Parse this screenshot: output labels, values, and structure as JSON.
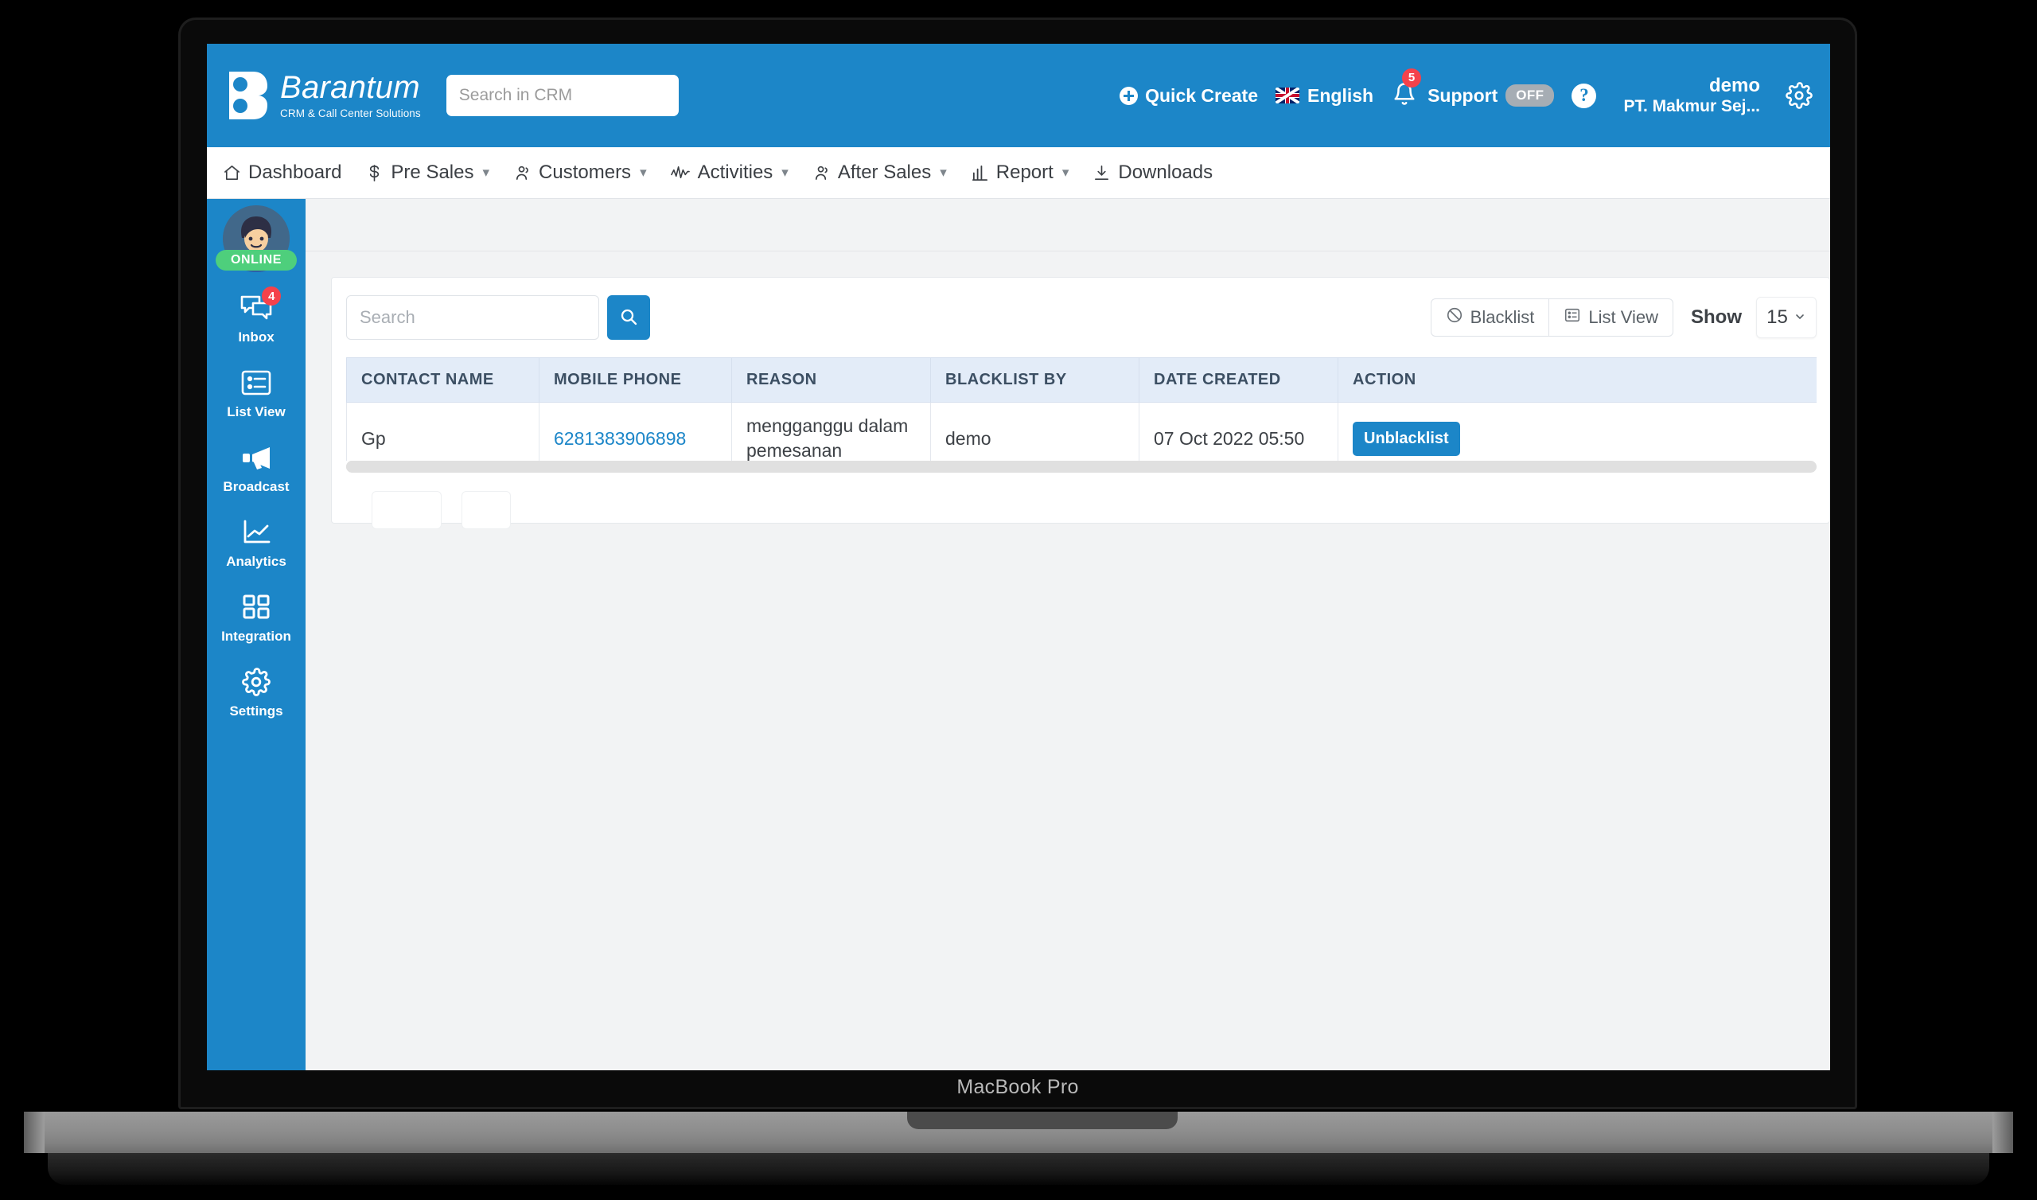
{
  "device": {
    "label": "MacBook Pro"
  },
  "header": {
    "brand_name": "Barantum",
    "brand_tagline": "CRM & Call Center Solutions",
    "search_placeholder": "Search in CRM",
    "search_value": "",
    "quick_create": "Quick Create",
    "language": "English",
    "notifications_count": "5",
    "support_label": "Support",
    "support_state": "OFF",
    "help": "?",
    "user_name": "demo",
    "user_company": "PT. Makmur Sej...",
    "accent_color": "#1c86c8"
  },
  "nav": {
    "items": [
      {
        "label": "Dashboard",
        "icon": "home-icon",
        "caret": false
      },
      {
        "label": "Pre Sales",
        "icon": "dollar-icon",
        "caret": true
      },
      {
        "label": "Customers",
        "icon": "people-icon",
        "caret": true
      },
      {
        "label": "Activities",
        "icon": "activity-icon",
        "caret": true
      },
      {
        "label": "After Sales",
        "icon": "people-icon",
        "caret": true
      },
      {
        "label": "Report",
        "icon": "bar-chart-icon",
        "caret": true
      },
      {
        "label": "Downloads",
        "icon": "download-icon",
        "caret": false
      }
    ]
  },
  "sidebar": {
    "status": "ONLINE",
    "items": [
      {
        "label": "Inbox",
        "icon": "chat-icon",
        "badge": "4"
      },
      {
        "label": "List View",
        "icon": "list-icon",
        "badge": ""
      },
      {
        "label": "Broadcast",
        "icon": "megaphone-icon",
        "badge": ""
      },
      {
        "label": "Analytics",
        "icon": "line-chart-icon",
        "badge": ""
      },
      {
        "label": "Integration",
        "icon": "grid-icon",
        "badge": ""
      },
      {
        "label": "Settings",
        "icon": "gear-icon",
        "badge": ""
      }
    ]
  },
  "toolbar": {
    "search_placeholder": "Search",
    "search_value": "",
    "blacklist_label": "Blacklist",
    "listview_label": "List View",
    "show_label": "Show",
    "page_size": "15"
  },
  "table": {
    "columns": [
      "CONTACT NAME",
      "MOBILE PHONE",
      "REASON",
      "BLACKLIST BY",
      "DATE CREATED",
      "ACTION"
    ],
    "rows": [
      {
        "contact_name": "Gp",
        "mobile_phone": "6281383906898",
        "reason": "mengganggu dalam pemesanan",
        "blacklist_by": "demo",
        "date_created": "07 Oct 2022 05:50",
        "action_label": "Unblacklist"
      }
    ]
  },
  "fab": {
    "name": "whatsapp-button",
    "color": "#3fc14f"
  }
}
